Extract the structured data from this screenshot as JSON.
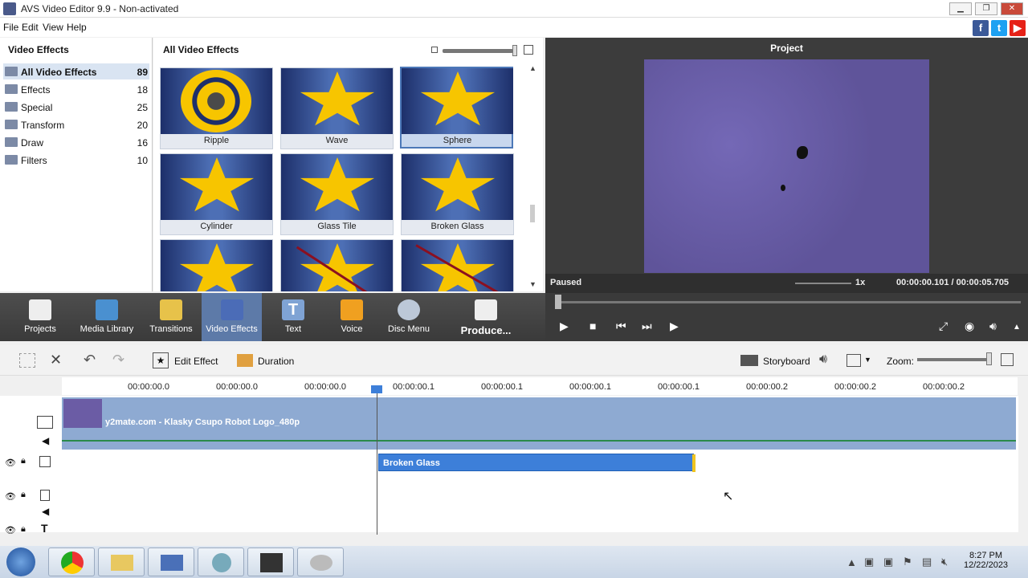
{
  "window": {
    "title": "AVS Video Editor 9.9 - Non-activated"
  },
  "menu": [
    "File",
    "Edit",
    "View",
    "Help"
  ],
  "left": {
    "header": "Video Effects",
    "categories": [
      {
        "name": "All Video Effects",
        "count": "89"
      },
      {
        "name": "Effects",
        "count": "18"
      },
      {
        "name": "Special",
        "count": "25"
      },
      {
        "name": "Transform",
        "count": "20"
      },
      {
        "name": "Draw",
        "count": "16"
      },
      {
        "name": "Filters",
        "count": "10"
      }
    ]
  },
  "grid": {
    "header": "All Video Effects",
    "effects": [
      "Ripple",
      "Wave",
      "Sphere",
      "Cylinder",
      "Glass Tile",
      "Broken Glass"
    ],
    "selected": "Sphere"
  },
  "preview": {
    "header": "Project",
    "status": "Paused",
    "speed": "1x",
    "time": "00:00:00.101 / 00:00:05.705"
  },
  "toolbar": [
    "Projects",
    "Media Library",
    "Transitions",
    "Video Effects",
    "Text",
    "Voice",
    "Disc Menu",
    "Produce..."
  ],
  "timeline_tools": {
    "edit_effect": "Edit Effect",
    "duration": "Duration",
    "storyboard": "Storyboard",
    "zoom": "Zoom:"
  },
  "ruler": [
    "00:00:00.0",
    "00:00:00.0",
    "00:00:00.0",
    "00:00:00.1",
    "00:00:00.1",
    "00:00:00.1",
    "00:00:00.1",
    "00:00:00.2",
    "00:00:00.2",
    "00:00:00.2"
  ],
  "tracks": {
    "video_clip": "y2mate.com - Klasky Csupo Robot Logo_480p",
    "effect_clip": "Broken Glass"
  },
  "taskbar": {
    "time": "8:27 PM",
    "date": "12/22/2023"
  },
  "colors": {
    "accent": "#3d7fd9",
    "toolbar_active": "#5d7aa8",
    "star": "#f7c500"
  }
}
